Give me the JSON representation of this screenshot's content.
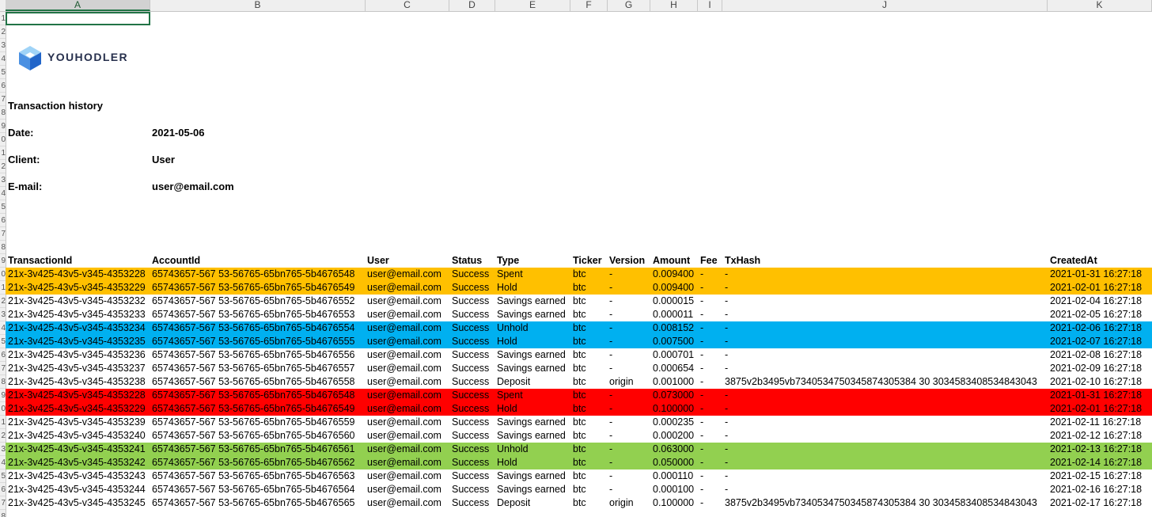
{
  "columns": [
    "A",
    "B",
    "C",
    "D",
    "E",
    "F",
    "G",
    "H",
    "I",
    "J",
    "K"
  ],
  "row_numbers": [
    "1",
    "2",
    "3",
    "4",
    "5",
    "6",
    "7",
    "8",
    "9",
    "0",
    "1",
    "2",
    "3",
    "4",
    "5",
    "6",
    "7",
    "8",
    "9",
    "0",
    "1",
    "2",
    "3",
    "4",
    "5",
    "6",
    "7",
    "8",
    "9",
    "0",
    "1",
    "2",
    "3",
    "4",
    "5",
    "6",
    "7",
    "8"
  ],
  "brand": "YOUHODLER",
  "report": {
    "title": "Transaction history",
    "date_label": "Date:",
    "date_value": "2021-05-06",
    "client_label": "Client:",
    "client_value": "User",
    "email_label": "E-mail:",
    "email_value": "user@email.com"
  },
  "table": {
    "headers": [
      "TransactionId",
      "AccountId",
      "User",
      "Status",
      "Type",
      "Ticker",
      "Version",
      "Amount",
      "Fee",
      "TxHash",
      "CreatedAt"
    ],
    "rows": [
      {
        "fill": "#ffc000",
        "cells": [
          "21x-3v425-43v5-v345-4353228",
          "65743657-567 53-56765-65bn765-5b4676548",
          "user@email.com",
          "Success",
          "Spent",
          "btc",
          "-",
          "0.009400",
          "-",
          "-",
          "2021-01-31 16:27:18"
        ]
      },
      {
        "fill": "#ffc000",
        "cells": [
          "21x-3v425-43v5-v345-4353229",
          "65743657-567 53-56765-65bn765-5b4676549",
          "user@email.com",
          "Success",
          "Hold",
          "btc",
          "-",
          "0.009400",
          "-",
          "-",
          "2021-02-01 16:27:18"
        ]
      },
      {
        "fill": "",
        "cells": [
          "21x-3v425-43v5-v345-4353232",
          "65743657-567 53-56765-65bn765-5b4676552",
          "user@email.com",
          "Success",
          "Savings earned",
          "btc",
          "-",
          "0.000015",
          "-",
          "-",
          "2021-02-04 16:27:18"
        ]
      },
      {
        "fill": "",
        "cells": [
          "21x-3v425-43v5-v345-4353233",
          "65743657-567 53-56765-65bn765-5b4676553",
          "user@email.com",
          "Success",
          "Savings earned",
          "btc",
          "-",
          "0.000011",
          "-",
          "-",
          "2021-02-05 16:27:18"
        ]
      },
      {
        "fill": "#00b0f0",
        "cells": [
          "21x-3v425-43v5-v345-4353234",
          "65743657-567 53-56765-65bn765-5b4676554",
          "user@email.com",
          "Success",
          "Unhold",
          "btc",
          "-",
          "0.008152",
          "-",
          "-",
          "2021-02-06 16:27:18"
        ]
      },
      {
        "fill": "#00b0f0",
        "cells": [
          "21x-3v425-43v5-v345-4353235",
          "65743657-567 53-56765-65bn765-5b4676555",
          "user@email.com",
          "Success",
          "Hold",
          "btc",
          "-",
          "0.007500",
          "-",
          "-",
          "2021-02-07 16:27:18"
        ]
      },
      {
        "fill": "",
        "cells": [
          "21x-3v425-43v5-v345-4353236",
          "65743657-567 53-56765-65bn765-5b4676556",
          "user@email.com",
          "Success",
          "Savings earned",
          "btc",
          "-",
          "0.000701",
          "-",
          "-",
          "2021-02-08 16:27:18"
        ]
      },
      {
        "fill": "",
        "cells": [
          "21x-3v425-43v5-v345-4353237",
          "65743657-567 53-56765-65bn765-5b4676557",
          "user@email.com",
          "Success",
          "Savings earned",
          "btc",
          "-",
          "0.000654",
          "-",
          "-",
          "2021-02-09 16:27:18"
        ]
      },
      {
        "fill": "",
        "cells": [
          "21x-3v425-43v5-v345-4353238",
          "65743657-567 53-56765-65bn765-5b4676558",
          "user@email.com",
          "Success",
          "Deposit",
          "btc",
          "origin",
          "0.001000",
          "-",
          "3875v2b3495vb7340534750345874305384 30 3034583408534843043",
          "2021-02-10 16:27:18"
        ]
      },
      {
        "fill": "#ff0000",
        "cells": [
          "21x-3v425-43v5-v345-4353228",
          "65743657-567 53-56765-65bn765-5b4676548",
          "user@email.com",
          "Success",
          "Spent",
          "btc",
          "-",
          "0.073000",
          "-",
          "-",
          "2021-01-31 16:27:18"
        ]
      },
      {
        "fill": "#ff0000",
        "cells": [
          "21x-3v425-43v5-v345-4353229",
          "65743657-567 53-56765-65bn765-5b4676549",
          "user@email.com",
          "Success",
          "Hold",
          "btc",
          "-",
          "0.100000",
          "-",
          "-",
          "2021-02-01 16:27:18"
        ]
      },
      {
        "fill": "",
        "cells": [
          "21x-3v425-43v5-v345-4353239",
          "65743657-567 53-56765-65bn765-5b4676559",
          "user@email.com",
          "Success",
          "Savings earned",
          "btc",
          "-",
          "0.000235",
          "-",
          "-",
          "2021-02-11 16:27:18"
        ]
      },
      {
        "fill": "",
        "cells": [
          "21x-3v425-43v5-v345-4353240",
          "65743657-567 53-56765-65bn765-5b4676560",
          "user@email.com",
          "Success",
          "Savings earned",
          "btc",
          "-",
          "0.000200",
          "-",
          "-",
          "2021-02-12 16:27:18"
        ]
      },
      {
        "fill": "#92d050",
        "cells": [
          "21x-3v425-43v5-v345-4353241",
          "65743657-567 53-56765-65bn765-5b4676561",
          "user@email.com",
          "Success",
          "Unhold",
          "btc",
          "-",
          "0.063000",
          "-",
          "-",
          "2021-02-13 16:27:18"
        ]
      },
      {
        "fill": "#92d050",
        "cells": [
          "21x-3v425-43v5-v345-4353242",
          "65743657-567 53-56765-65bn765-5b4676562",
          "user@email.com",
          "Success",
          "Hold",
          "btc",
          "-",
          "0.050000",
          "-",
          "-",
          "2021-02-14 16:27:18"
        ]
      },
      {
        "fill": "",
        "cells": [
          "21x-3v425-43v5-v345-4353243",
          "65743657-567 53-56765-65bn765-5b4676563",
          "user@email.com",
          "Success",
          "Savings earned",
          "btc",
          "-",
          "0.000110",
          "-",
          "-",
          "2021-02-15 16:27:18"
        ]
      },
      {
        "fill": "",
        "cells": [
          "21x-3v425-43v5-v345-4353244",
          "65743657-567 53-56765-65bn765-5b4676564",
          "user@email.com",
          "Success",
          "Savings earned",
          "btc",
          "-",
          "0.000100",
          "-",
          "-",
          "2021-02-16 16:27:18"
        ]
      },
      {
        "fill": "",
        "cells": [
          "21x-3v425-43v5-v345-4353245",
          "65743657-567 53-56765-65bn765-5b4676565",
          "user@email.com",
          "Success",
          "Deposit",
          "btc",
          "origin",
          "0.100000",
          "-",
          "3875v2b3495vb7340534750345874305384 30 3034583408534843043",
          "2021-02-17 16:27:18"
        ]
      }
    ]
  },
  "colors": {
    "orange": "#ffc000",
    "blue": "#00b0f0",
    "red": "#ff0000",
    "green": "#92d050",
    "selection": "#217346"
  }
}
